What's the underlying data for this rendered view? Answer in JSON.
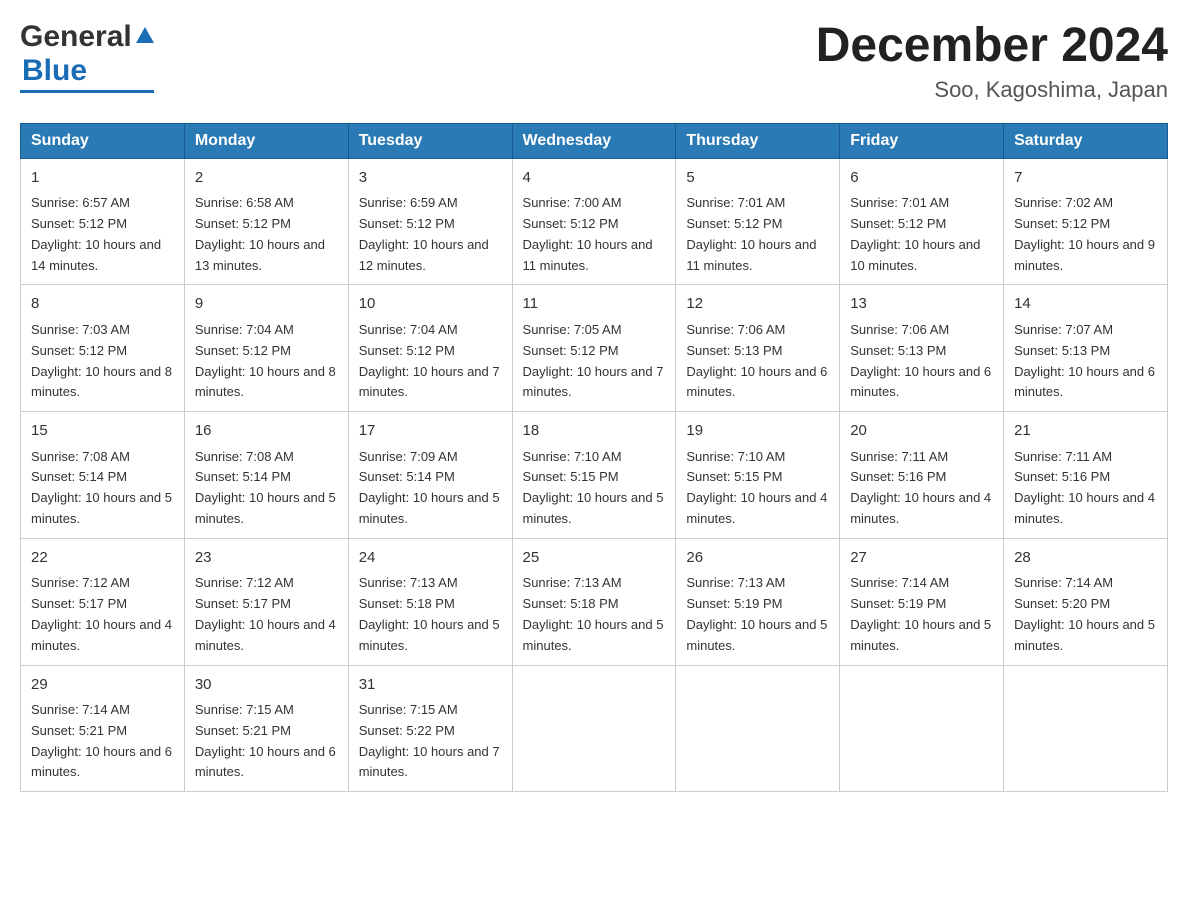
{
  "header": {
    "logo_general": "General",
    "logo_blue": "Blue",
    "month_title": "December 2024",
    "location": "Soo, Kagoshima, Japan"
  },
  "days_of_week": [
    "Sunday",
    "Monday",
    "Tuesday",
    "Wednesday",
    "Thursday",
    "Friday",
    "Saturday"
  ],
  "weeks": [
    [
      {
        "day": "1",
        "sunrise": "6:57 AM",
        "sunset": "5:12 PM",
        "daylight": "10 hours and 14 minutes."
      },
      {
        "day": "2",
        "sunrise": "6:58 AM",
        "sunset": "5:12 PM",
        "daylight": "10 hours and 13 minutes."
      },
      {
        "day": "3",
        "sunrise": "6:59 AM",
        "sunset": "5:12 PM",
        "daylight": "10 hours and 12 minutes."
      },
      {
        "day": "4",
        "sunrise": "7:00 AM",
        "sunset": "5:12 PM",
        "daylight": "10 hours and 11 minutes."
      },
      {
        "day": "5",
        "sunrise": "7:01 AM",
        "sunset": "5:12 PM",
        "daylight": "10 hours and 11 minutes."
      },
      {
        "day": "6",
        "sunrise": "7:01 AM",
        "sunset": "5:12 PM",
        "daylight": "10 hours and 10 minutes."
      },
      {
        "day": "7",
        "sunrise": "7:02 AM",
        "sunset": "5:12 PM",
        "daylight": "10 hours and 9 minutes."
      }
    ],
    [
      {
        "day": "8",
        "sunrise": "7:03 AM",
        "sunset": "5:12 PM",
        "daylight": "10 hours and 8 minutes."
      },
      {
        "day": "9",
        "sunrise": "7:04 AM",
        "sunset": "5:12 PM",
        "daylight": "10 hours and 8 minutes."
      },
      {
        "day": "10",
        "sunrise": "7:04 AM",
        "sunset": "5:12 PM",
        "daylight": "10 hours and 7 minutes."
      },
      {
        "day": "11",
        "sunrise": "7:05 AM",
        "sunset": "5:12 PM",
        "daylight": "10 hours and 7 minutes."
      },
      {
        "day": "12",
        "sunrise": "7:06 AM",
        "sunset": "5:13 PM",
        "daylight": "10 hours and 6 minutes."
      },
      {
        "day": "13",
        "sunrise": "7:06 AM",
        "sunset": "5:13 PM",
        "daylight": "10 hours and 6 minutes."
      },
      {
        "day": "14",
        "sunrise": "7:07 AM",
        "sunset": "5:13 PM",
        "daylight": "10 hours and 6 minutes."
      }
    ],
    [
      {
        "day": "15",
        "sunrise": "7:08 AM",
        "sunset": "5:14 PM",
        "daylight": "10 hours and 5 minutes."
      },
      {
        "day": "16",
        "sunrise": "7:08 AM",
        "sunset": "5:14 PM",
        "daylight": "10 hours and 5 minutes."
      },
      {
        "day": "17",
        "sunrise": "7:09 AM",
        "sunset": "5:14 PM",
        "daylight": "10 hours and 5 minutes."
      },
      {
        "day": "18",
        "sunrise": "7:10 AM",
        "sunset": "5:15 PM",
        "daylight": "10 hours and 5 minutes."
      },
      {
        "day": "19",
        "sunrise": "7:10 AM",
        "sunset": "5:15 PM",
        "daylight": "10 hours and 4 minutes."
      },
      {
        "day": "20",
        "sunrise": "7:11 AM",
        "sunset": "5:16 PM",
        "daylight": "10 hours and 4 minutes."
      },
      {
        "day": "21",
        "sunrise": "7:11 AM",
        "sunset": "5:16 PM",
        "daylight": "10 hours and 4 minutes."
      }
    ],
    [
      {
        "day": "22",
        "sunrise": "7:12 AM",
        "sunset": "5:17 PM",
        "daylight": "10 hours and 4 minutes."
      },
      {
        "day": "23",
        "sunrise": "7:12 AM",
        "sunset": "5:17 PM",
        "daylight": "10 hours and 4 minutes."
      },
      {
        "day": "24",
        "sunrise": "7:13 AM",
        "sunset": "5:18 PM",
        "daylight": "10 hours and 5 minutes."
      },
      {
        "day": "25",
        "sunrise": "7:13 AM",
        "sunset": "5:18 PM",
        "daylight": "10 hours and 5 minutes."
      },
      {
        "day": "26",
        "sunrise": "7:13 AM",
        "sunset": "5:19 PM",
        "daylight": "10 hours and 5 minutes."
      },
      {
        "day": "27",
        "sunrise": "7:14 AM",
        "sunset": "5:19 PM",
        "daylight": "10 hours and 5 minutes."
      },
      {
        "day": "28",
        "sunrise": "7:14 AM",
        "sunset": "5:20 PM",
        "daylight": "10 hours and 5 minutes."
      }
    ],
    [
      {
        "day": "29",
        "sunrise": "7:14 AM",
        "sunset": "5:21 PM",
        "daylight": "10 hours and 6 minutes."
      },
      {
        "day": "30",
        "sunrise": "7:15 AM",
        "sunset": "5:21 PM",
        "daylight": "10 hours and 6 minutes."
      },
      {
        "day": "31",
        "sunrise": "7:15 AM",
        "sunset": "5:22 PM",
        "daylight": "10 hours and 7 minutes."
      },
      null,
      null,
      null,
      null
    ]
  ],
  "sunrise_label": "Sunrise:",
  "sunset_label": "Sunset:",
  "daylight_label": "Daylight:"
}
